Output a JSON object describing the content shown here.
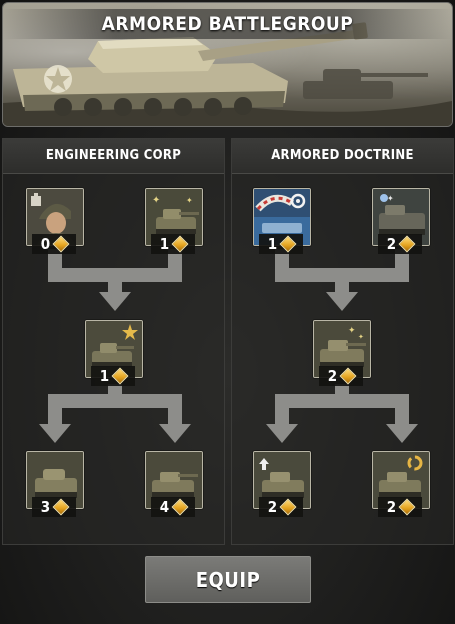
{
  "banner": {
    "title": "ARMORED BATTLEGROUP"
  },
  "panels": [
    {
      "title": "ENGINEERING CORP",
      "nodes": [
        {
          "icon": "soldier-portrait-icon",
          "cost": "0"
        },
        {
          "icon": "tank-sparkle-icon",
          "cost": "1"
        },
        {
          "icon": "tank-star-icon",
          "cost": "1"
        },
        {
          "icon": "tank-icon",
          "cost": "3"
        },
        {
          "icon": "tank-destroyer-icon",
          "cost": "4"
        }
      ]
    },
    {
      "title": "ARMORED DOCTRINE",
      "nodes": [
        {
          "icon": "repair-wrench-icon",
          "cost": "1"
        },
        {
          "icon": "tank-flame-icon",
          "cost": "2"
        },
        {
          "icon": "tank-sparkle-icon",
          "cost": "2"
        },
        {
          "icon": "tank-upgrade-icon",
          "cost": "2"
        },
        {
          "icon": "tank-cycle-icon",
          "cost": "2"
        }
      ]
    }
  ],
  "equip_label": "EQUIP",
  "colors": {
    "gem": "#e3a21e",
    "arrow": "#8d8d8a",
    "node_border": "#b9b6a6"
  }
}
